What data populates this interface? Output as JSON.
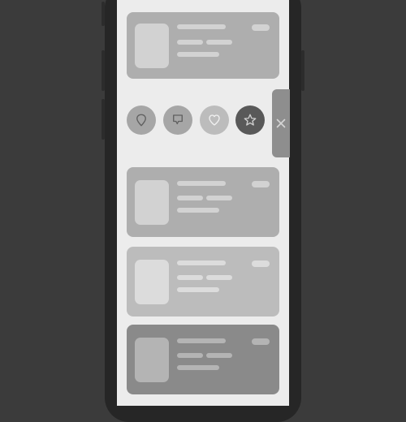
{
  "colors": {
    "background": "#3b3b3b",
    "phone_body": "#262626",
    "screen": "#ececec",
    "card_light": "#aeaeae",
    "card_lighter": "#bcbcbc",
    "card_dark": "#8a8a8a",
    "placeholder_light": "#d2d2d2",
    "placeholder_dark": "#b4b4b4"
  },
  "cards": [
    {
      "name": "card-1",
      "tone": "light"
    },
    {
      "name": "card-2",
      "tone": "light"
    },
    {
      "name": "card-3",
      "tone": "lighter"
    },
    {
      "name": "card-4",
      "tone": "dark"
    }
  ],
  "swipe_actions": [
    {
      "icon": "pin-icon"
    },
    {
      "icon": "flag-icon"
    },
    {
      "icon": "heart-icon"
    },
    {
      "icon": "star-icon"
    }
  ],
  "close_tab": {
    "icon": "close-icon",
    "symbol": "✕"
  }
}
